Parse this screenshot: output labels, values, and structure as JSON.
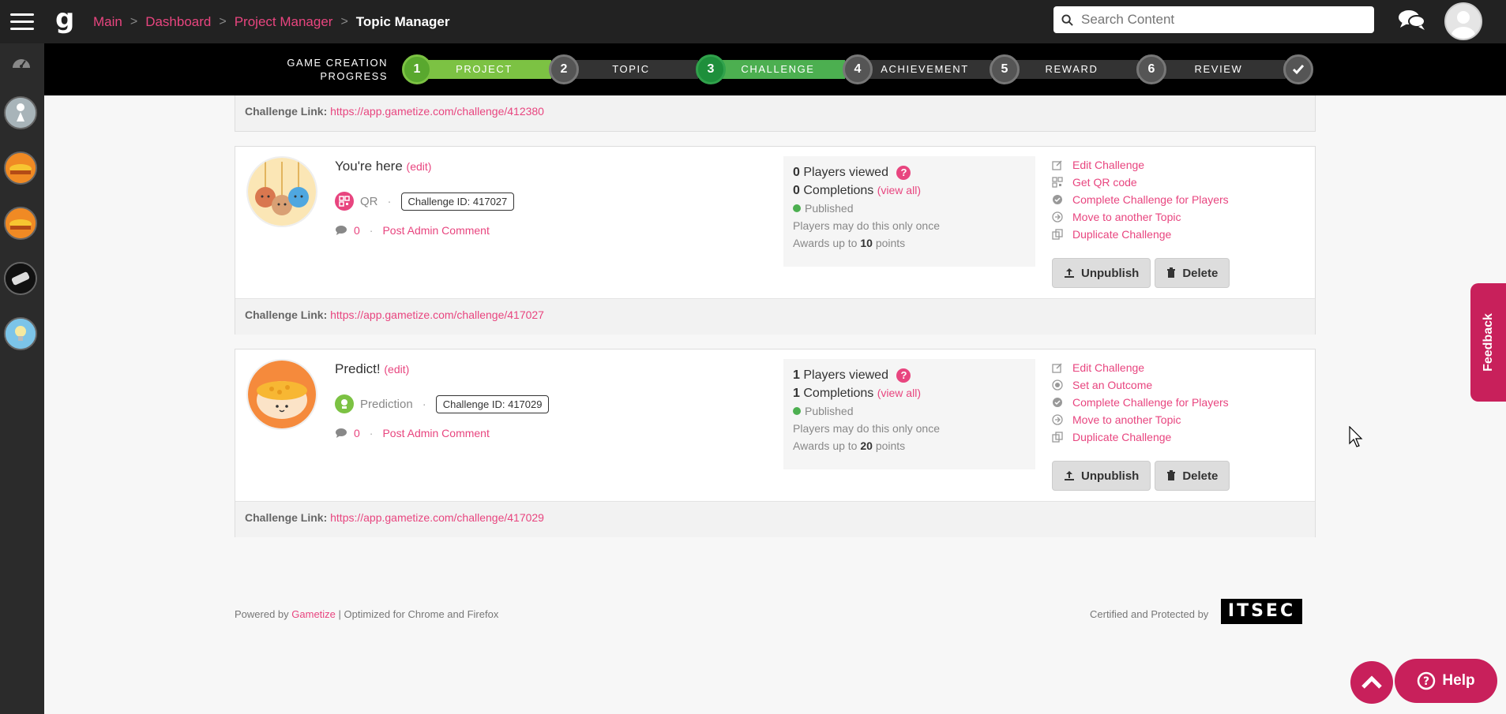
{
  "breadcrumb": {
    "items": [
      "Main",
      "Dashboard",
      "Project Manager"
    ],
    "current": "Topic Manager"
  },
  "search": {
    "placeholder": "Search Content"
  },
  "progress": {
    "label_line1": "GAME CREATION",
    "label_line2": "PROGRESS",
    "steps": [
      {
        "num": "1",
        "label": "PROJECT"
      },
      {
        "num": "2",
        "label": "TOPIC"
      },
      {
        "num": "3",
        "label": "CHALLENGE"
      },
      {
        "num": "4",
        "label": "ACHIEVEMENT"
      },
      {
        "num": "5",
        "label": "REWARD"
      },
      {
        "num": "6",
        "label": "REVIEW"
      }
    ],
    "final_icon": "check-icon"
  },
  "top_card": {
    "link_label": "Challenge Link:",
    "link_url": "https://app.gametize.com/challenge/412380"
  },
  "challenges": [
    {
      "title": "You're here",
      "edit": "(edit)",
      "type": "QR",
      "challenge_id": "Challenge ID: 417027",
      "comments": "0",
      "post_comment": "Post Admin Comment",
      "players_viewed_num": "0",
      "players_viewed_text": "Players viewed",
      "completions_num": "0",
      "completions_text": "Completions",
      "view_all": "(view all)",
      "status": "Published",
      "frequency": "Players may do this only once",
      "awards_prefix": "Awards up to",
      "points": "10",
      "points_suffix": "points",
      "actions": [
        "Edit Challenge",
        "Get QR code",
        "Complete Challenge for Players",
        "Move to another Topic",
        "Duplicate Challenge"
      ],
      "unpublish": "Unpublish",
      "delete": "Delete",
      "link_label": "Challenge Link:",
      "link_url": "https://app.gametize.com/challenge/417027"
    },
    {
      "title": "Predict!",
      "edit": "(edit)",
      "type": "Prediction",
      "challenge_id": "Challenge ID: 417029",
      "comments": "0",
      "post_comment": "Post Admin Comment",
      "players_viewed_num": "1",
      "players_viewed_text": "Players viewed",
      "completions_num": "1",
      "completions_text": "Completions",
      "view_all": "(view all)",
      "status": "Published",
      "frequency": "Players may do this only once",
      "awards_prefix": "Awards up to",
      "points": "20",
      "points_suffix": "points",
      "actions": [
        "Edit Challenge",
        "Set an Outcome",
        "Complete Challenge for Players",
        "Move to another Topic",
        "Duplicate Challenge"
      ],
      "unpublish": "Unpublish",
      "delete": "Delete",
      "link_label": "Challenge Link:",
      "link_url": "https://app.gametize.com/challenge/417029"
    }
  ],
  "footer": {
    "powered_prefix": "Powered by",
    "brand": "Gametize",
    "powered_suffix": "| Optimized for Chrome and Firefox",
    "certified": "Certified and Protected by",
    "itsec": "ITSEC"
  },
  "feedback": "Feedback",
  "help": "Help",
  "colors": {
    "accent": "#e8457f",
    "progress_done": "#4caf50",
    "topbar": "#222222"
  }
}
